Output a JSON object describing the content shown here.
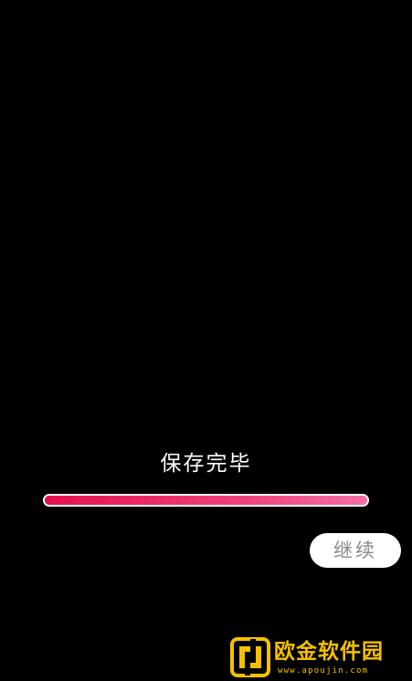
{
  "status": {
    "text": "保存完毕"
  },
  "progress": {
    "percent": 100
  },
  "actions": {
    "continue_label": "继续"
  },
  "watermark": {
    "title": "欧金软件园",
    "url": "www.apoujin.com"
  },
  "colors": {
    "background": "#000000",
    "progress_start": "#e5104f",
    "progress_end": "#f56fa6",
    "button_bg": "#ffffff",
    "button_text": "#8a8a8a",
    "watermark": "#f5c000"
  }
}
